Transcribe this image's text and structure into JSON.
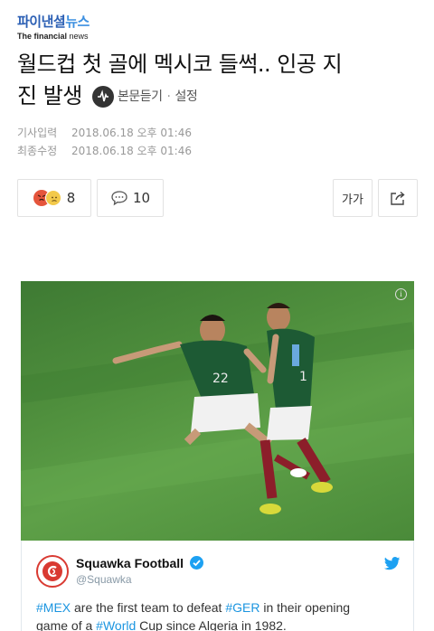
{
  "masthead": {
    "logo_main": "파이낸셜",
    "logo_sub": "뉴스",
    "logo_en_bold": "The financial",
    "logo_en_rest": " news"
  },
  "article": {
    "title_part1": "월드컵 첫 골에 멕시코 들썩.. 인공 지",
    "title_part2": "진 발생",
    "listen_label": "본문듣기",
    "settings_label": "설정",
    "input_label": "기사입력",
    "input_time": "2018.06.18 오후 01:46",
    "modified_label": "최종수정",
    "modified_time": "2018.06.18 오후 01:46"
  },
  "actions": {
    "reaction_count": "8",
    "comment_count": "10",
    "font_label": "가가"
  },
  "embed": {
    "info_symbol": "i"
  },
  "tweet": {
    "author": "Squawka Football",
    "handle": "@Squawka",
    "tag1": "#MEX",
    "text1": " are the first team to defeat ",
    "tag2": "#GER",
    "text2": " in their opening",
    "text3": "game of a ",
    "tag3": "#World",
    "text4": " Cup since Algeria in 1982."
  },
  "colors": {
    "brand_blue": "#2b5fb4",
    "twitter_blue": "#1da1f2",
    "pitch_green": "#4f8f3d",
    "mexico_green": "#1d5a34",
    "squawka_red": "#d93a32"
  }
}
